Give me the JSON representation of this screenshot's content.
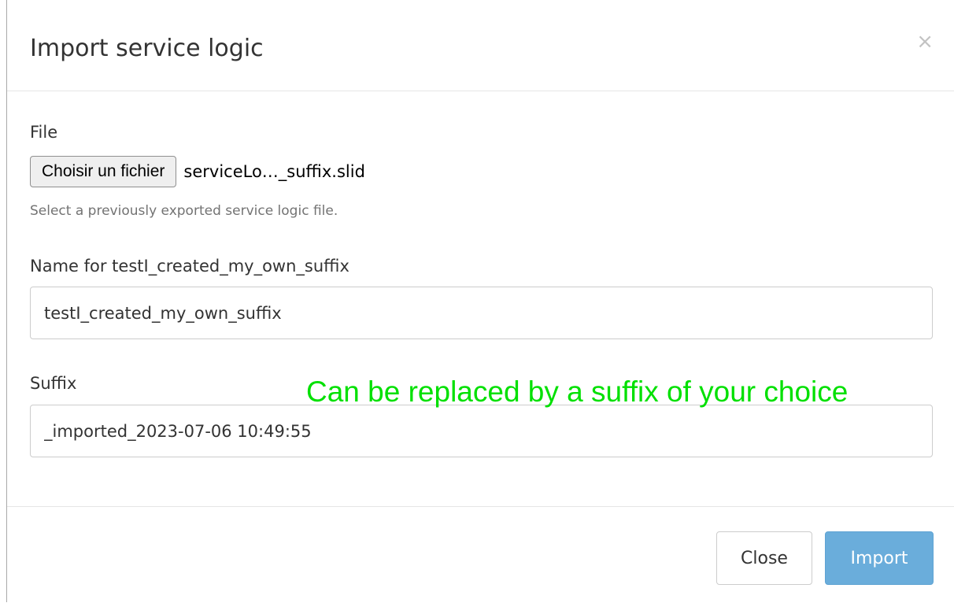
{
  "dialog": {
    "title": "Import service logic",
    "close_icon": "×"
  },
  "file_field": {
    "label": "File",
    "button_label": "Choisir un fichier",
    "file_name": "serviceLo…_suffix.slid",
    "help": "Select a previously exported service logic file."
  },
  "name_field": {
    "label": "Name for testI_created_my_own_suffix",
    "value": "testI_created_my_own_suffix"
  },
  "suffix_field": {
    "label": "Suffix",
    "value": "_imported_2023-07-06 10:49:55"
  },
  "annotation": {
    "text": "Can be replaced by a suffix of your choice",
    "color": "#00e000"
  },
  "footer": {
    "close_label": "Close",
    "import_label": "Import"
  },
  "colors": {
    "primary_button": "#6aaddb"
  }
}
